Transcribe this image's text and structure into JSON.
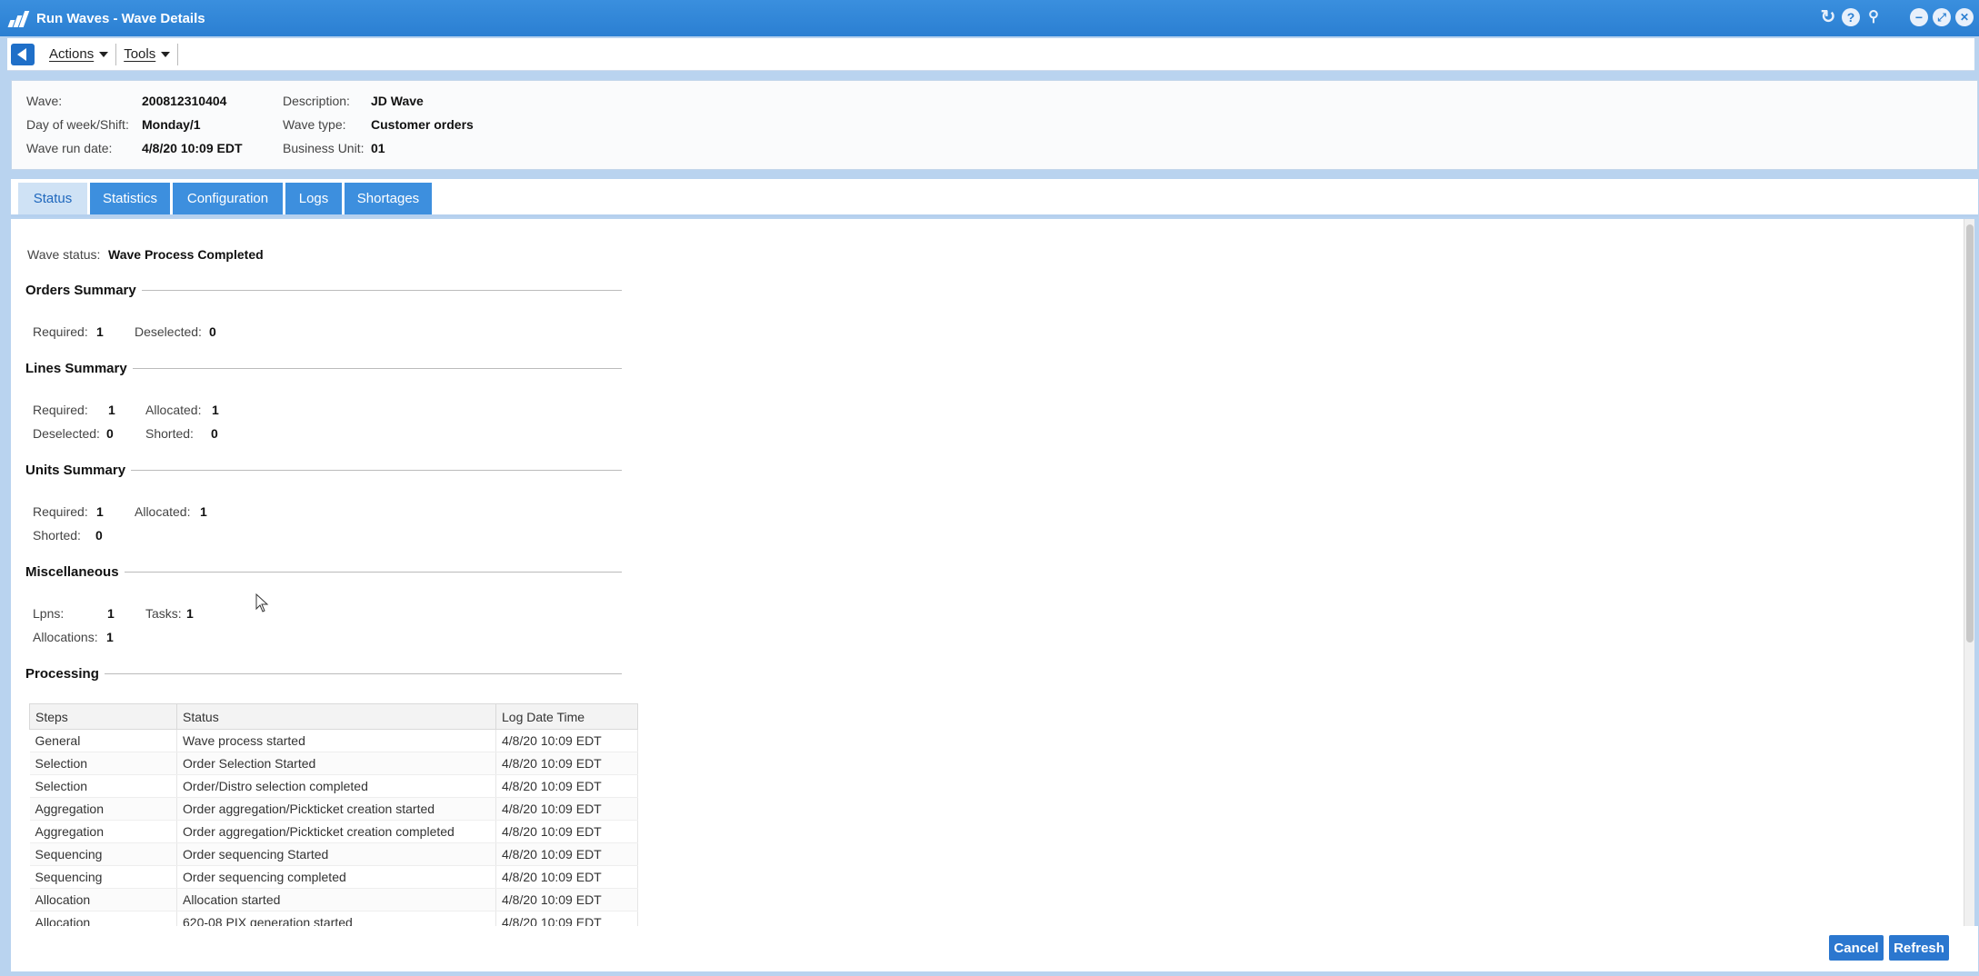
{
  "window": {
    "title": "Run Waves - Wave Details"
  },
  "title_icons": [
    "refresh-icon",
    "help-icon",
    "pin-icon",
    "minimize-icon",
    "restore-icon",
    "close-icon"
  ],
  "toolbar": {
    "actions_label": "Actions",
    "tools_label": "Tools"
  },
  "header": {
    "wave_label": "Wave:",
    "wave_value": "200812310404",
    "day_label": "Day of week/Shift:",
    "day_value": "Monday/1",
    "rundate_label": "Wave run date:",
    "rundate_value": "4/8/20 10:09 EDT",
    "desc_label": "Description:",
    "desc_value": "JD Wave",
    "type_label": "Wave type:",
    "type_value": "Customer orders",
    "bu_label": "Business Unit:",
    "bu_value": "01"
  },
  "tabs": [
    "Status",
    "Statistics",
    "Configuration",
    "Logs",
    "Shortages"
  ],
  "status": {
    "wave_status_label": "Wave status:",
    "wave_status_value": "Wave Process Completed",
    "orders": {
      "title": "Orders Summary",
      "required_label": "Required:",
      "required": "1",
      "deselected_label": "Deselected:",
      "deselected": "0"
    },
    "lines": {
      "title": "Lines Summary",
      "required_label": "Required:",
      "required": "1",
      "allocated_label": "Allocated:",
      "allocated": "1",
      "deselected_label": "Deselected:",
      "deselected": "0",
      "shorted_label": "Shorted:",
      "shorted": "0"
    },
    "units": {
      "title": "Units Summary",
      "required_label": "Required:",
      "required": "1",
      "allocated_label": "Allocated:",
      "allocated": "1",
      "shorted_label": "Shorted:",
      "shorted": "0"
    },
    "misc": {
      "title": "Miscellaneous",
      "lpns_label": "Lpns:",
      "lpns": "1",
      "tasks_label": "Tasks:",
      "tasks": "1",
      "allocations_label": "Allocations:",
      "allocations": "1"
    },
    "processing_title": "Processing"
  },
  "processing": {
    "columns": [
      "Steps",
      "Status",
      "Log Date Time"
    ],
    "rows": [
      [
        "General",
        "Wave process started",
        "4/8/20 10:09 EDT"
      ],
      [
        "Selection",
        "Order Selection Started",
        "4/8/20 10:09 EDT"
      ],
      [
        "Selection",
        "Order/Distro selection completed",
        "4/8/20 10:09 EDT"
      ],
      [
        "Aggregation",
        "Order aggregation/Pickticket creation started",
        "4/8/20 10:09 EDT"
      ],
      [
        "Aggregation",
        "Order aggregation/Pickticket creation completed",
        "4/8/20 10:09 EDT"
      ],
      [
        "Sequencing",
        "Order sequencing Started",
        "4/8/20 10:09 EDT"
      ],
      [
        "Sequencing",
        "Order sequencing completed",
        "4/8/20 10:09 EDT"
      ],
      [
        "Allocation",
        "Allocation started",
        "4/8/20 10:09 EDT"
      ],
      [
        "Allocation",
        "620-08 PIX generation started",
        "4/8/20 10:09 EDT"
      ]
    ]
  },
  "footer": {
    "cancel_label": "Cancel",
    "refresh_label": "Refresh"
  },
  "colors": {
    "titlebar": "#2b7fd2",
    "tab": "#3d8fde",
    "tab_active": "#cfe2f5",
    "button": "#2b77cf"
  }
}
